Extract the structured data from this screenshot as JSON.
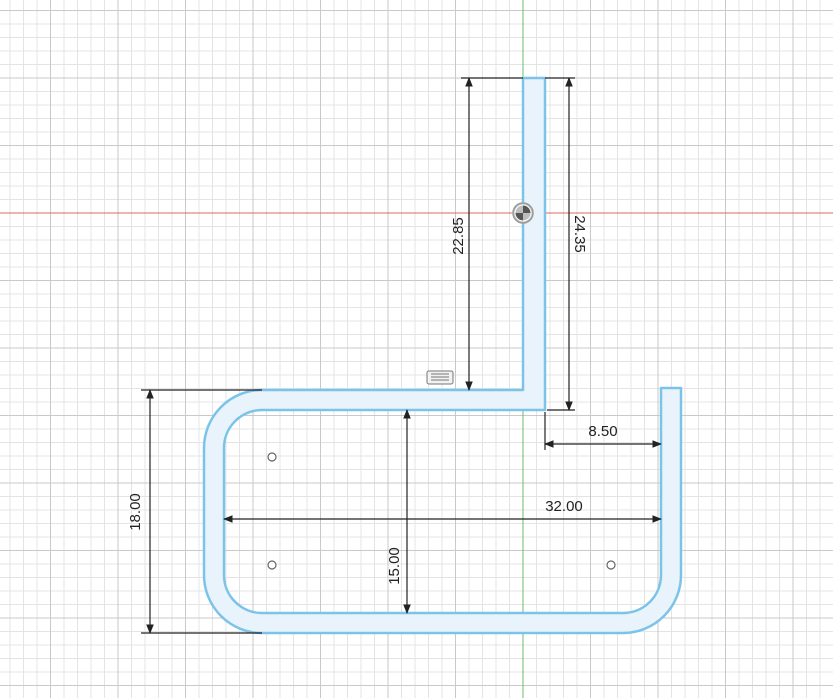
{
  "sketch": {
    "colors": {
      "background": "#ffffff",
      "grid_minor": "#e4e4e4",
      "grid_major": "#c9c9c9",
      "x_axis": "#e06666",
      "y_axis": "#6abf69",
      "profile_stroke": "#7cc3ea",
      "profile_fill": "#e8f3fb",
      "dimension": "#222222"
    },
    "dimensions": {
      "vertical_left_upper": "22.85",
      "vertical_right_upper": "24.35",
      "horizontal_gap": "8.50",
      "horizontal_width": "32.00",
      "vertical_outer_height": "18.00",
      "vertical_inner_height": "15.00"
    },
    "glyphs": {
      "origin": "origin-point-icon",
      "dimension_marker": "dimension-marker-icon",
      "hole": "hole-point-icon"
    }
  }
}
